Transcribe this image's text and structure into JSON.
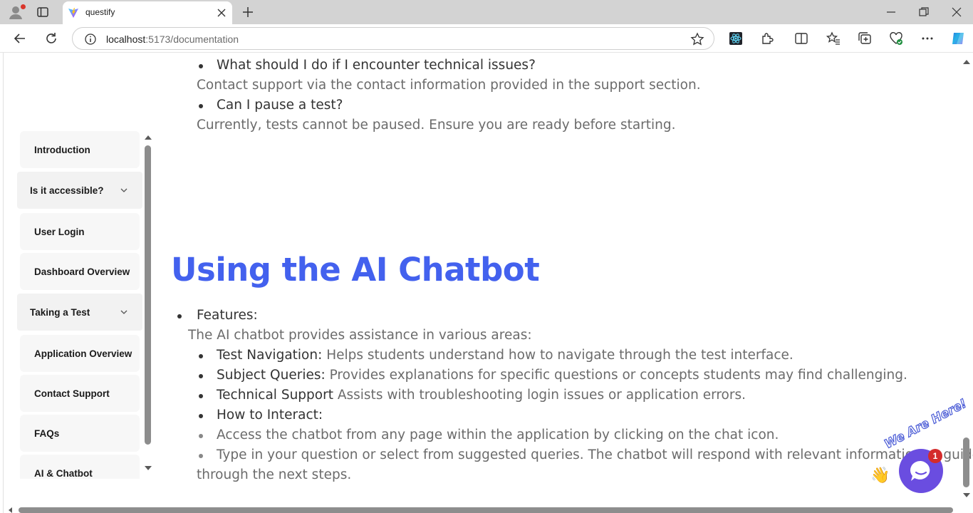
{
  "browser": {
    "tab_title": "questify",
    "url_host": "localhost",
    "url_rest": ":5173/documentation"
  },
  "sidebar": {
    "items": [
      {
        "label": "Introduction"
      },
      {
        "label": "Is it accessible?"
      },
      {
        "label": "User Login"
      },
      {
        "label": "Dashboard Overview"
      },
      {
        "label": "Taking a Test"
      },
      {
        "label": "Application Overview"
      },
      {
        "label": "Contact Support"
      },
      {
        "label": "FAQs"
      },
      {
        "label": "AI & Chatbot"
      }
    ]
  },
  "faq": {
    "q1": "What should I do if I encounter technical issues?",
    "a1": "Contact support via the contact information provided in the support section.",
    "q2": "Can I pause a test?",
    "a2": "Currently, tests cannot be paused. Ensure you are ready before starting."
  },
  "chatbot_section": {
    "heading": "Using the AI Chatbot",
    "features_label": "Features:",
    "features_intro": "The AI chatbot provides assistance in various areas:",
    "items": [
      {
        "strong": "Test Navigation:",
        "text": " Helps students understand how to navigate through the test interface."
      },
      {
        "strong": "Subject Queries:",
        "text": " Provides explanations for specific questions or concepts students may find challenging."
      },
      {
        "strong": "Technical Support",
        "text": " Assists with troubleshooting login issues or application errors."
      }
    ],
    "interact_label": "How to Interact:",
    "interact_items": [
      "Access the chatbot from any page within the application by clicking on the chat icon.",
      "Type in your question or select from suggested queries. The chatbot will respond with relevant information or guide"
    ],
    "interact_wrap": "through the next steps."
  },
  "chat_widget": {
    "banner": "We Are Here!",
    "badge": "1"
  }
}
